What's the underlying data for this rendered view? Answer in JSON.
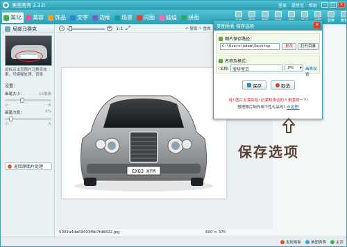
{
  "window": {
    "title": "美图秀秀 2.3.0",
    "top_links": [
      "登录",
      "提意见",
      "帮助"
    ]
  },
  "tabs": [
    {
      "label": "美化",
      "active": true,
      "color": "#3fae4d"
    },
    {
      "label": "美容",
      "active": false,
      "color": "#e15b8d"
    },
    {
      "label": "饰品",
      "active": false,
      "color": "#f2a22f"
    },
    {
      "label": "文字",
      "active": false,
      "color": "#2f86d6"
    },
    {
      "label": "边框",
      "active": false,
      "color": "#6d62c9"
    },
    {
      "label": "场景",
      "active": false,
      "color": "#17a0a8"
    },
    {
      "label": "闪图",
      "active": false,
      "color": "#e0432f"
    },
    {
      "label": "娃娃",
      "active": false,
      "color": "#f06fa6"
    },
    {
      "label": "拼图",
      "active": false,
      "color": "#2fa96a"
    }
  ],
  "toolbar_tools": [
    "打开",
    "保存",
    "截图",
    "旋转",
    "裁剪",
    "尺寸",
    "涂鸦",
    "替换",
    "撤销"
  ],
  "left_panel": {
    "title": "局部马赛克",
    "hint": "鼠标点击您照片马赛克效果，可模糊处理，背景",
    "settings_label": "设置：",
    "brush_size_label": "画笔大小：",
    "brush_size_value": "15像素",
    "brush_size_min": "小",
    "brush_size_max": "大",
    "brush_strength_label": "画笔力度：",
    "brush_strength_value": "6%",
    "brush_strength_min": "小",
    "brush_strength_max": "大",
    "undo_button": "返回原图片处理"
  },
  "view_bar": {
    "ratio": "1:1",
    "undo_redo": "↶ 撤销  ↷ 重做"
  },
  "canvas": {
    "plate_text": "EXO3 HYM",
    "file_name": "5002a4da69493f5b7fd6822.jpg",
    "image_size": "600 × 375"
  },
  "save_dialog": {
    "title": "美图秀秀 保存选项",
    "close": "×",
    "path_section_label": "图片保存路径：",
    "path_value": "C:\\Users\\Adam\\Desktop",
    "change_button": "更改",
    "open_folder_button": "打开目录",
    "name_section_label": "名称及格式：",
    "name_label": "名称:",
    "name_value": "宝华宝贝",
    "format_value": ".JPG",
    "quality_link": "画质设置",
    "save_button": "保存",
    "cancel_button": "取消",
    "promo_line": "哇! 图片太漂亮啦! 赶紧和身边的人来围观一下!",
    "promo_line2": "想把照片制作成个性礼品吗?",
    "promo_link": "点这里!"
  },
  "annotation": {
    "text": "保存选项",
    "color": "#5b4034"
  },
  "bottom_bar": [
    "发射刷新",
    "美图秀秀",
    "主页"
  ],
  "colors": {
    "accent": "#2a9db3",
    "close": "#d8412f",
    "promo": "#d21f1f"
  }
}
